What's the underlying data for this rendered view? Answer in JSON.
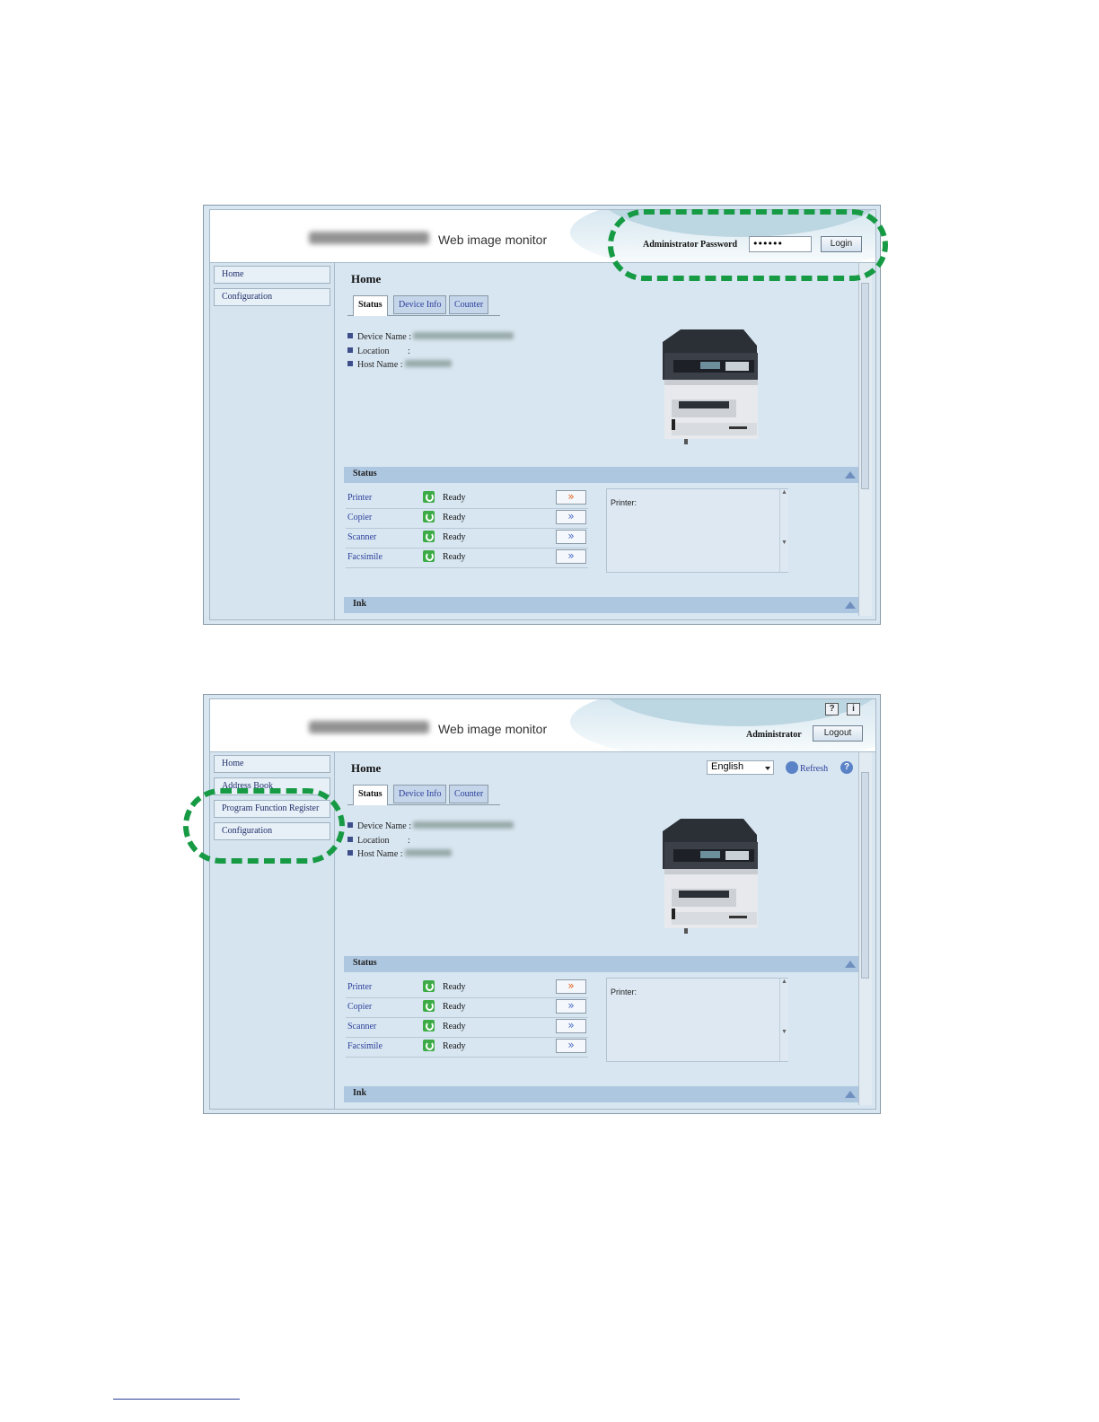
{
  "app_title": "Web image monitor",
  "screens": [
    {
      "sidebar": [
        "Home",
        "Configuration"
      ],
      "header": {
        "password_label": "Administrator Password",
        "password_value": "••••••",
        "login_label": "Login"
      }
    },
    {
      "sidebar": [
        "Home",
        "Address Book",
        "Program Function Register",
        "Configuration"
      ],
      "header": {
        "help_icon": "?",
        "info_icon": "i",
        "user_label": "Administrator",
        "logout_label": "Logout",
        "language": "English",
        "refresh_label": "Refresh",
        "page_help_icon": "?"
      }
    }
  ],
  "page_title": "Home",
  "tabs": [
    "Status",
    "Device Info",
    "Counter"
  ],
  "info_labels": {
    "device_name": "Device Name",
    "location": "Location",
    "host_name": "Host Name",
    "sep": ":"
  },
  "status_section": {
    "title": "Status",
    "rows": [
      {
        "name": "Printer",
        "state": "Ready",
        "arrow": "»"
      },
      {
        "name": "Copier",
        "state": "Ready",
        "arrow": "»"
      },
      {
        "name": "Scanner",
        "state": "Ready",
        "arrow": "»"
      },
      {
        "name": "Facsimile",
        "state": "Ready",
        "arrow": "»"
      }
    ],
    "message_title": "Printer:"
  },
  "ink_section": {
    "title": "Ink"
  },
  "colors": {
    "callout": "#179a44",
    "panel": "#d8e6f1",
    "ready": "#3cab45",
    "link": "#2b3f9a"
  }
}
